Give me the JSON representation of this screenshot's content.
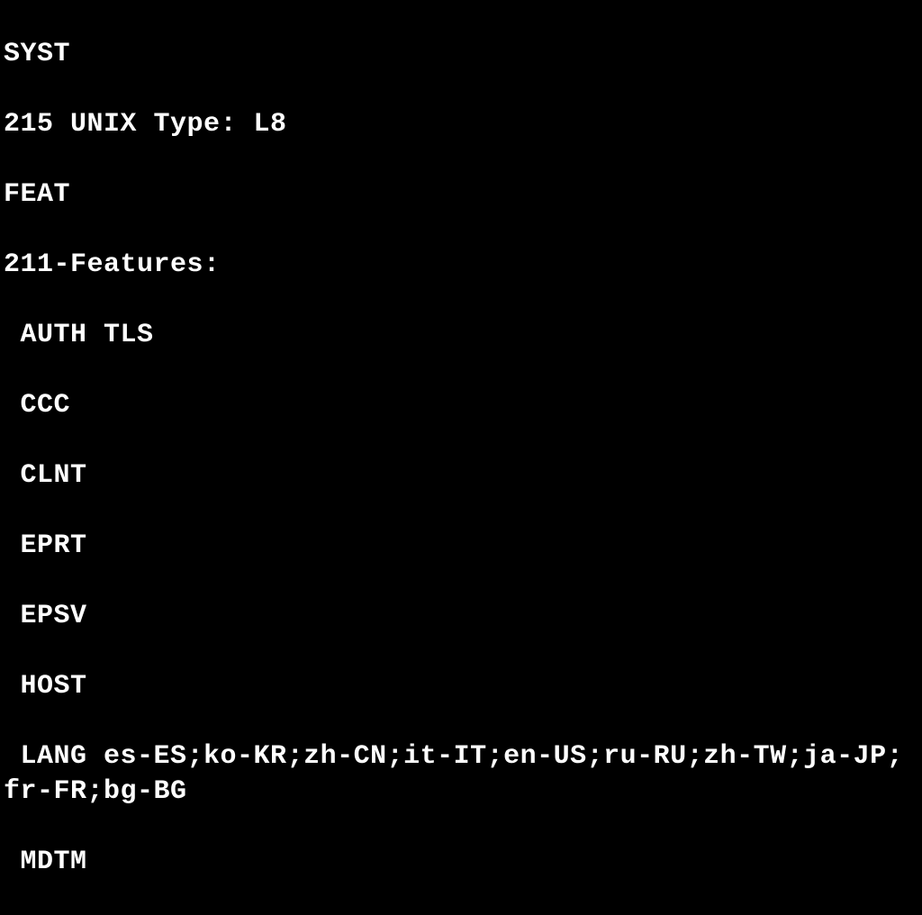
{
  "terminal": {
    "lines": [
      "SYST",
      "215 UNIX Type: L8",
      "FEAT",
      "211-Features:",
      " AUTH TLS",
      " CCC",
      " CLNT",
      " EPRT",
      " EPSV",
      " HOST",
      " LANG es-ES;ko-KR;zh-CN;it-IT;en-US;ru-RU;zh-TW;ja-JP;fr-FR;bg-BG",
      " MDTM"
    ]
  }
}
